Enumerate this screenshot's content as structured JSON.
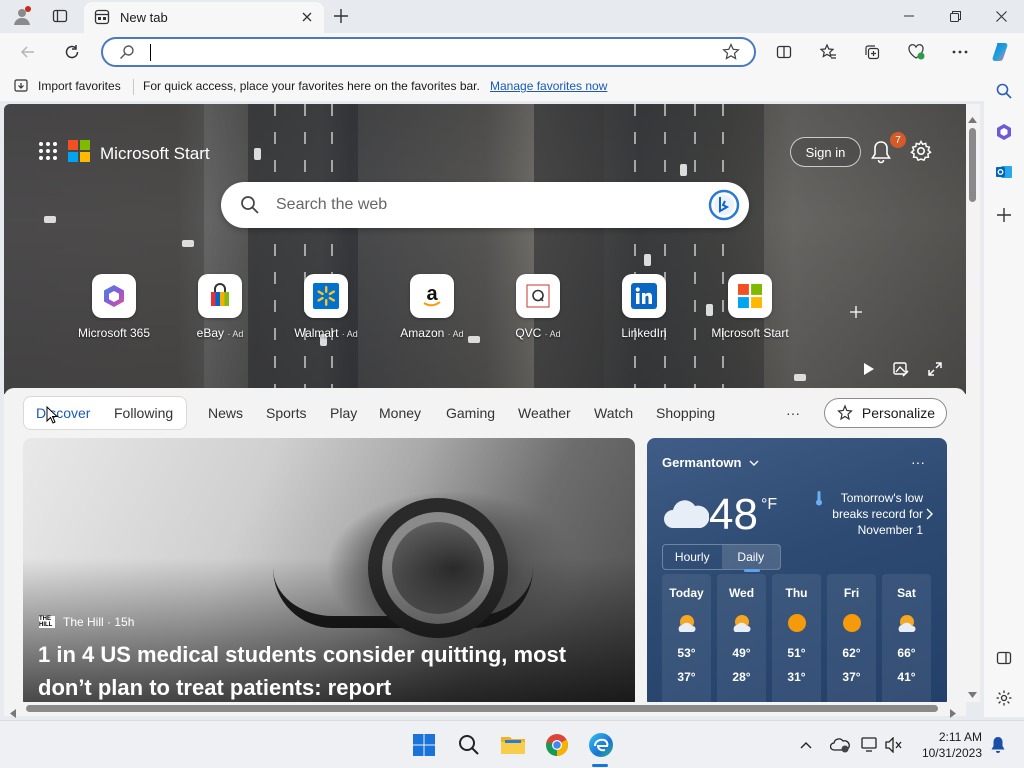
{
  "browser": {
    "tab_title": "New tab",
    "address_value": "",
    "import_favorites": "Import favorites",
    "favbar_message": "For quick access, place your favorites here on the favorites bar.",
    "favbar_link": "Manage favorites now"
  },
  "start": {
    "brand": "Microsoft Start",
    "sign_in": "Sign in",
    "notification_count": "7",
    "search_placeholder": "Search the web",
    "tiles": [
      {
        "name": "Microsoft 365",
        "ad": ""
      },
      {
        "name": "eBay",
        "ad": "· Ad"
      },
      {
        "name": "Walmart",
        "ad": "· Ad"
      },
      {
        "name": "Amazon",
        "ad": "· Ad"
      },
      {
        "name": "QVC",
        "ad": "· Ad"
      },
      {
        "name": "LinkedIn",
        "ad": ""
      },
      {
        "name": "Microsoft Start",
        "ad": ""
      }
    ]
  },
  "feed": {
    "tabs": [
      "Discover",
      "Following",
      "News",
      "Sports",
      "Play",
      "Money",
      "Gaming",
      "Weather",
      "Watch",
      "Shopping"
    ],
    "more": "···",
    "personalize": "Personalize"
  },
  "article": {
    "source": "The Hill · 15h",
    "source_logo": "THE HILL",
    "headline": "1 in 4 US medical students consider quitting, most don’t plan to treat patients: report"
  },
  "weather": {
    "location": "Germantown",
    "more": "···",
    "temp": "48",
    "unit": "°F",
    "note": "Tomorrow's low breaks record for November 1",
    "toggle": [
      "Hourly",
      "Daily"
    ],
    "days": [
      {
        "name": "Today",
        "hi": "53°",
        "lo": "37°",
        "icon": "partly-sunny-icon"
      },
      {
        "name": "Wed",
        "hi": "49°",
        "lo": "28°",
        "icon": "partly-sunny-icon"
      },
      {
        "name": "Thu",
        "hi": "51°",
        "lo": "31°",
        "icon": "sunny-icon"
      },
      {
        "name": "Fri",
        "hi": "62°",
        "lo": "37°",
        "icon": "sunny-icon"
      },
      {
        "name": "Sat",
        "hi": "66°",
        "lo": "41°",
        "icon": "partly-sunny-icon"
      }
    ]
  },
  "taskbar": {
    "time": "2:11 AM",
    "date": "10/31/2023"
  },
  "colors": {
    "accent": "#1a5ab8",
    "weather_bg": "#2d4a72",
    "badge": "#d55a2a"
  }
}
